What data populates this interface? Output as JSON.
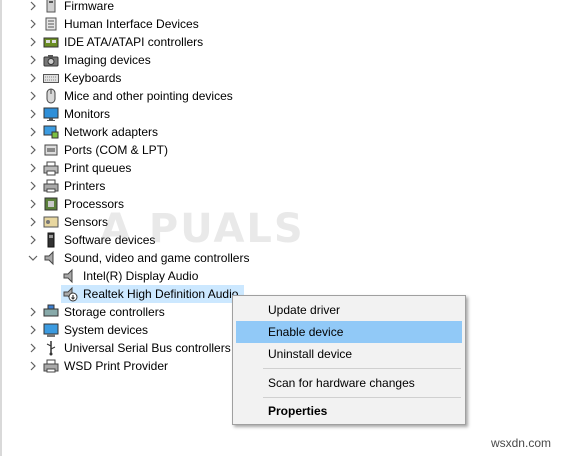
{
  "tree": {
    "items": [
      {
        "label": "Firmware",
        "icon": "firmware-icon",
        "expanded": false
      },
      {
        "label": "Human Interface Devices",
        "icon": "hid-icon",
        "expanded": false
      },
      {
        "label": "IDE ATA/ATAPI controllers",
        "icon": "ide-controller-icon",
        "expanded": false
      },
      {
        "label": "Imaging devices",
        "icon": "camera-icon",
        "expanded": false
      },
      {
        "label": "Keyboards",
        "icon": "keyboard-icon",
        "expanded": false
      },
      {
        "label": "Mice and other pointing devices",
        "icon": "mouse-icon",
        "expanded": false
      },
      {
        "label": "Monitors",
        "icon": "monitor-icon",
        "expanded": false
      },
      {
        "label": "Network adapters",
        "icon": "network-adapter-icon",
        "expanded": false
      },
      {
        "label": "Ports (COM & LPT)",
        "icon": "port-icon",
        "expanded": false
      },
      {
        "label": "Print queues",
        "icon": "print-queue-icon",
        "expanded": false
      },
      {
        "label": "Printers",
        "icon": "printer-icon",
        "expanded": false
      },
      {
        "label": "Processors",
        "icon": "processor-icon",
        "expanded": false
      },
      {
        "label": "Sensors",
        "icon": "sensor-icon",
        "expanded": false
      },
      {
        "label": "Software devices",
        "icon": "software-device-icon",
        "expanded": false
      },
      {
        "label": "Sound, video and game controllers",
        "icon": "speaker-icon",
        "expanded": true
      },
      {
        "label": "Intel(R) Display Audio",
        "icon": "speaker-icon",
        "child": true
      },
      {
        "label": "Realtek High Definition Audio",
        "icon": "speaker-disabled-icon",
        "child": true,
        "selected": true
      },
      {
        "label": "Storage controllers",
        "icon": "storage-controller-icon",
        "expanded": false
      },
      {
        "label": "System devices",
        "icon": "system-device-icon",
        "expanded": false
      },
      {
        "label": "Universal Serial Bus controllers",
        "icon": "usb-icon",
        "expanded": false
      },
      {
        "label": "WSD Print Provider",
        "icon": "wsd-printer-icon",
        "expanded": false
      }
    ]
  },
  "context_menu": {
    "update_driver": "Update driver",
    "enable_device": "Enable device",
    "uninstall_device": "Uninstall device",
    "scan_hardware": "Scan for hardware changes",
    "properties": "Properties"
  },
  "watermark": "A PUALS",
  "credit": "wsxdn.com",
  "colors": {
    "selection": "#cce8ff",
    "menu_highlight": "#91c9f7",
    "menu_bg": "#f2f2f2"
  }
}
